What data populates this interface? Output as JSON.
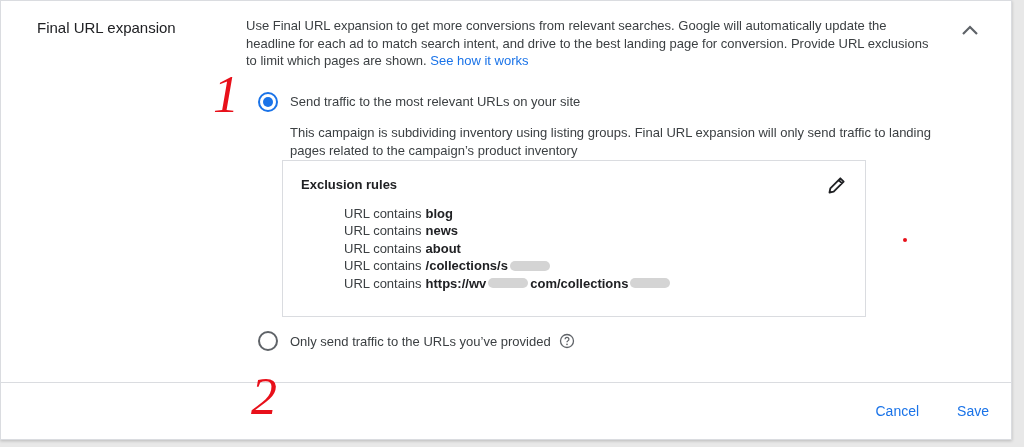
{
  "section": {
    "title": "Final URL expansion",
    "expanded": true,
    "description": "Use Final URL expansion to get more conversions from relevant searches. Google will automatically update the headline for each ad to match search intent, and drive to the best landing page for conversion. Provide URL exclusions to limit which pages are shown.",
    "link": "See how it works"
  },
  "options": [
    {
      "label": "Send traffic to the most relevant URLs on your site",
      "selected": true,
      "help": false,
      "note": "This campaign is subdividing inventory using listing groups. Final URL expansion will only send traffic to landing pages related to the campaign’s product inventory",
      "exclusions": {
        "title": "Exclusion rules",
        "rules": [
          {
            "label": "URL contains",
            "segments": [
              "blog"
            ],
            "redacted": false
          },
          {
            "label": "URL contains",
            "segments": [
              "news"
            ],
            "redacted": false
          },
          {
            "label": "URL contains",
            "segments": [
              "about"
            ],
            "redacted": false
          },
          {
            "label": "URL contains",
            "segments": [
              "/collections/s"
            ],
            "redacted": true
          },
          {
            "label": "URL contains",
            "segments": [
              "https://wv",
              "com/collections"
            ],
            "redacted": true
          }
        ]
      }
    },
    {
      "label": "Only send traffic to the URLs you’ve provided",
      "selected": false,
      "help": true
    }
  ],
  "buttons": [
    "Cancel",
    "Save"
  ],
  "annotations": [
    {
      "text": "1"
    },
    {
      "text": "2"
    }
  ]
}
